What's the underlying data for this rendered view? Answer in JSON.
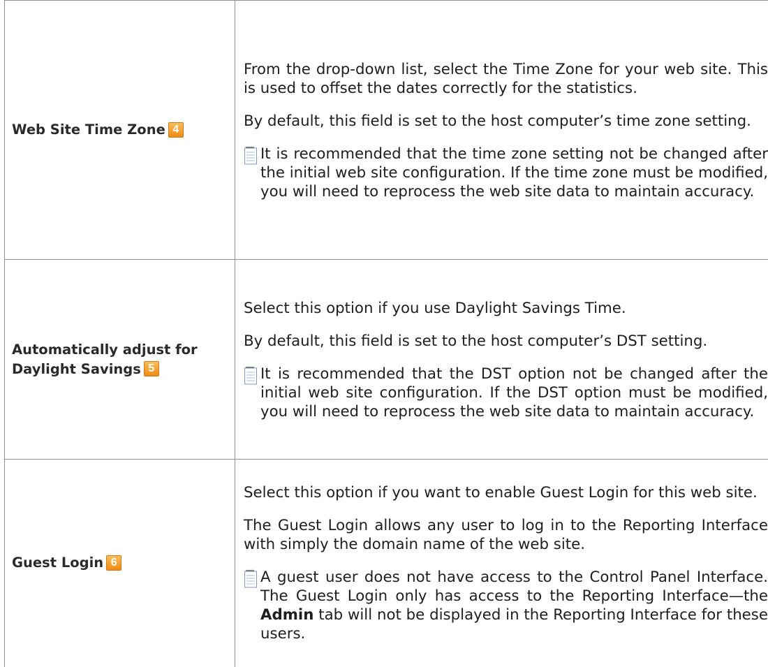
{
  "rows": [
    {
      "field_name": "Web Site Time Zone",
      "badge": "4",
      "paragraphs": [
        "From the drop-down list, select the Time Zone for your web site. This is used to offset the dates correctly for the statistics.",
        "By default, this field is set to the host computer’s time zone setting."
      ],
      "note": "It is recommended that the time zone setting not be changed after the initial web site configuration. If the time zone must be modified, you will need to reprocess the web site data to maintain accuracy."
    },
    {
      "field_name": "Automatically adjust for Daylight Savings",
      "badge": "5",
      "paragraphs": [
        "Select this option if you use Daylight Savings Time.",
        "By default, this field is set to the host computer’s DST setting."
      ],
      "note": "It is recommended that the DST option not be changed after the initial web site configuration.  If the DST option must be modified, you will need to reprocess the web site data to maintain accuracy."
    },
    {
      "field_name": "Guest Login",
      "badge": "6",
      "paragraphs": [
        "Select this option if you want to enable Guest Login for this web site.",
        "The Guest Login allows any user to log in to the Reporting Interface with simply the domain name of the web site."
      ],
      "note_parts": {
        "before": "A guest user does not have access to the Control Panel Interface.  The Guest Login only has access to the Reporting Interface—the ",
        "bold": "Admin",
        "after": " tab will not be displayed in the Reporting Interface for these users."
      }
    }
  ],
  "icons": {
    "note": "notepad-icon",
    "badge_color": "#f39c2b"
  }
}
